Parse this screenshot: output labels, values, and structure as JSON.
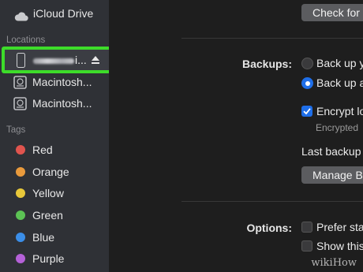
{
  "sidebar": {
    "icloud": {
      "label": "iCloud Drive",
      "icon": "cloud-icon"
    },
    "locations_header": "Locations",
    "device": {
      "label": "i...",
      "icon": "iphone-icon",
      "eject_icon": "eject-icon",
      "highlight_color": "#3ddc2a"
    },
    "disks": [
      {
        "label": "Macintosh...",
        "icon": "hard-drive-icon"
      },
      {
        "label": "Macintosh...",
        "icon": "hard-drive-icon"
      }
    ],
    "tags_header": "Tags",
    "tags": [
      {
        "label": "Red",
        "color": "#e0544e"
      },
      {
        "label": "Orange",
        "color": "#e99a3c"
      },
      {
        "label": "Yellow",
        "color": "#e8c83a"
      },
      {
        "label": "Green",
        "color": "#5cc254"
      },
      {
        "label": "Blue",
        "color": "#3b8ee8"
      },
      {
        "label": "Purple",
        "color": "#b561d8"
      }
    ]
  },
  "main": {
    "check_for_button": "Check for",
    "backups": {
      "label": "Backups:",
      "option1": "Back up y",
      "option2": "Back up a",
      "encrypt": "Encrypt lo",
      "encrypted_sub": "Encrypted",
      "last_backup": "Last backup",
      "manage_button": "Manage B"
    },
    "options": {
      "label": "Options:",
      "prefer": "Prefer sta",
      "show": "Show this"
    },
    "accent_color": "#1e6ee8"
  },
  "watermark": "wikiHow"
}
